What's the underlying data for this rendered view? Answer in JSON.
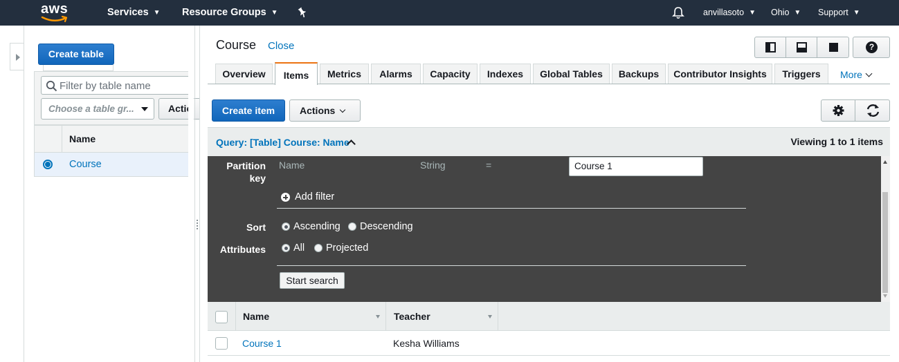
{
  "topnav": {
    "logo": "aws",
    "services": "Services",
    "resource_groups": "Resource Groups",
    "user": "anvillasoto",
    "region": "Ohio",
    "support": "Support",
    "icons": [
      "pin-icon",
      "bell-icon"
    ]
  },
  "sidebar": {
    "create_table": "Create table",
    "filter_placeholder": "Filter by table name",
    "group_placeholder": "Choose a table gr...",
    "actions_label": "Actio",
    "column_name": "Name",
    "tables": [
      {
        "name": "Course",
        "selected": true
      }
    ]
  },
  "main": {
    "title": "Course",
    "close_label": "Close",
    "tabs": [
      {
        "label": "Overview",
        "active": false
      },
      {
        "label": "Items",
        "active": true
      },
      {
        "label": "Metrics",
        "active": false
      },
      {
        "label": "Alarms",
        "active": false
      },
      {
        "label": "Capacity",
        "active": false
      },
      {
        "label": "Indexes",
        "active": false
      },
      {
        "label": "Global Tables",
        "active": false
      },
      {
        "label": "Backups",
        "active": false
      },
      {
        "label": "Contributor Insights",
        "active": false
      },
      {
        "label": "Triggers",
        "active": false
      }
    ],
    "more_label": "More",
    "create_item": "Create item",
    "actions": "Actions",
    "query": {
      "label": "Query: [Table] Course: Name",
      "viewing": "Viewing 1 to 1 items",
      "partition_key_label": "Partition key",
      "pk_name": "Name",
      "pk_type": "String",
      "pk_operator": "=",
      "pk_value": "Course 1",
      "add_filter": "Add filter",
      "sort_label": "Sort",
      "sort_options": [
        "Ascending",
        "Descending"
      ],
      "sort_selected": "Ascending",
      "attributes_label": "Attributes",
      "attribute_options": [
        "All",
        "Projected"
      ],
      "attribute_selected": "All",
      "start_search": "Start search"
    },
    "results": {
      "columns": [
        "Name",
        "Teacher"
      ],
      "rows": [
        {
          "name": "Course 1",
          "teacher": "Kesha Williams"
        }
      ]
    }
  },
  "colors": {
    "nav_bg": "#232f3e",
    "primary": "#1166bb",
    "link": "#0073bb",
    "tab_accent": "#ec7211",
    "query_panel": "#444444"
  }
}
